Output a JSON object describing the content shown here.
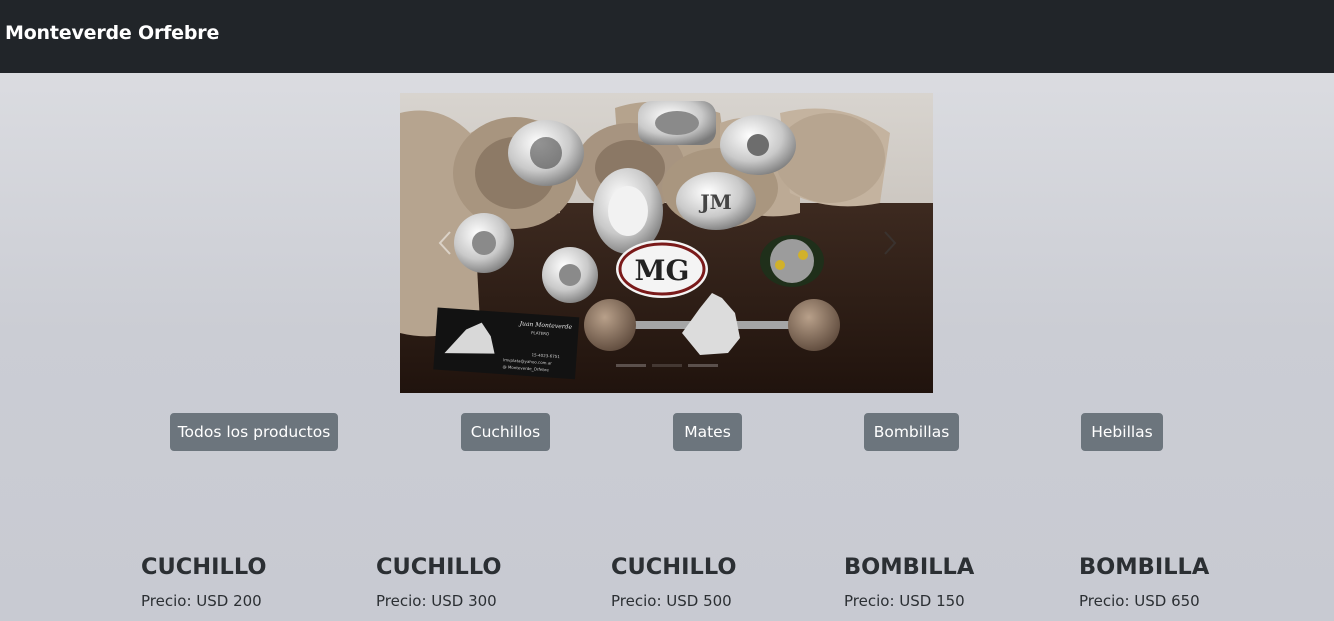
{
  "navbar": {
    "brand": "Monteverde Orfebre"
  },
  "carousel": {
    "image_description": "",
    "card_text": "Juan Monteverde",
    "card_subtitle": "PLATERO",
    "card_phone": "15-4023-6751",
    "card_email": "lmvplata@yahoo.com.ar",
    "card_handle": "@ Monteverde_Orfebre",
    "buckle_letters_1": "JM",
    "buckle_letters_2": "MG",
    "buckle_letters_3": "JM",
    "slide_count": 3,
    "active_slide": 1
  },
  "categories": [
    {
      "label": "Todos los productos"
    },
    {
      "label": "Cuchillos"
    },
    {
      "label": "Mates"
    },
    {
      "label": "Bombillas"
    },
    {
      "label": "Hebillas"
    }
  ],
  "products": [
    {
      "name": "CUCHILLO",
      "price": "Precio: USD 200"
    },
    {
      "name": "CUCHILLO",
      "price": "Precio: USD 300"
    },
    {
      "name": "CUCHILLO",
      "price": "Precio: USD 500"
    },
    {
      "name": "BOMBILLA",
      "price": "Precio: USD 150"
    },
    {
      "name": "BOMBILLA",
      "price": "Precio: USD 650"
    }
  ],
  "colors": {
    "navbar": "#212529",
    "button": "#6c757d",
    "text": "#212529"
  }
}
